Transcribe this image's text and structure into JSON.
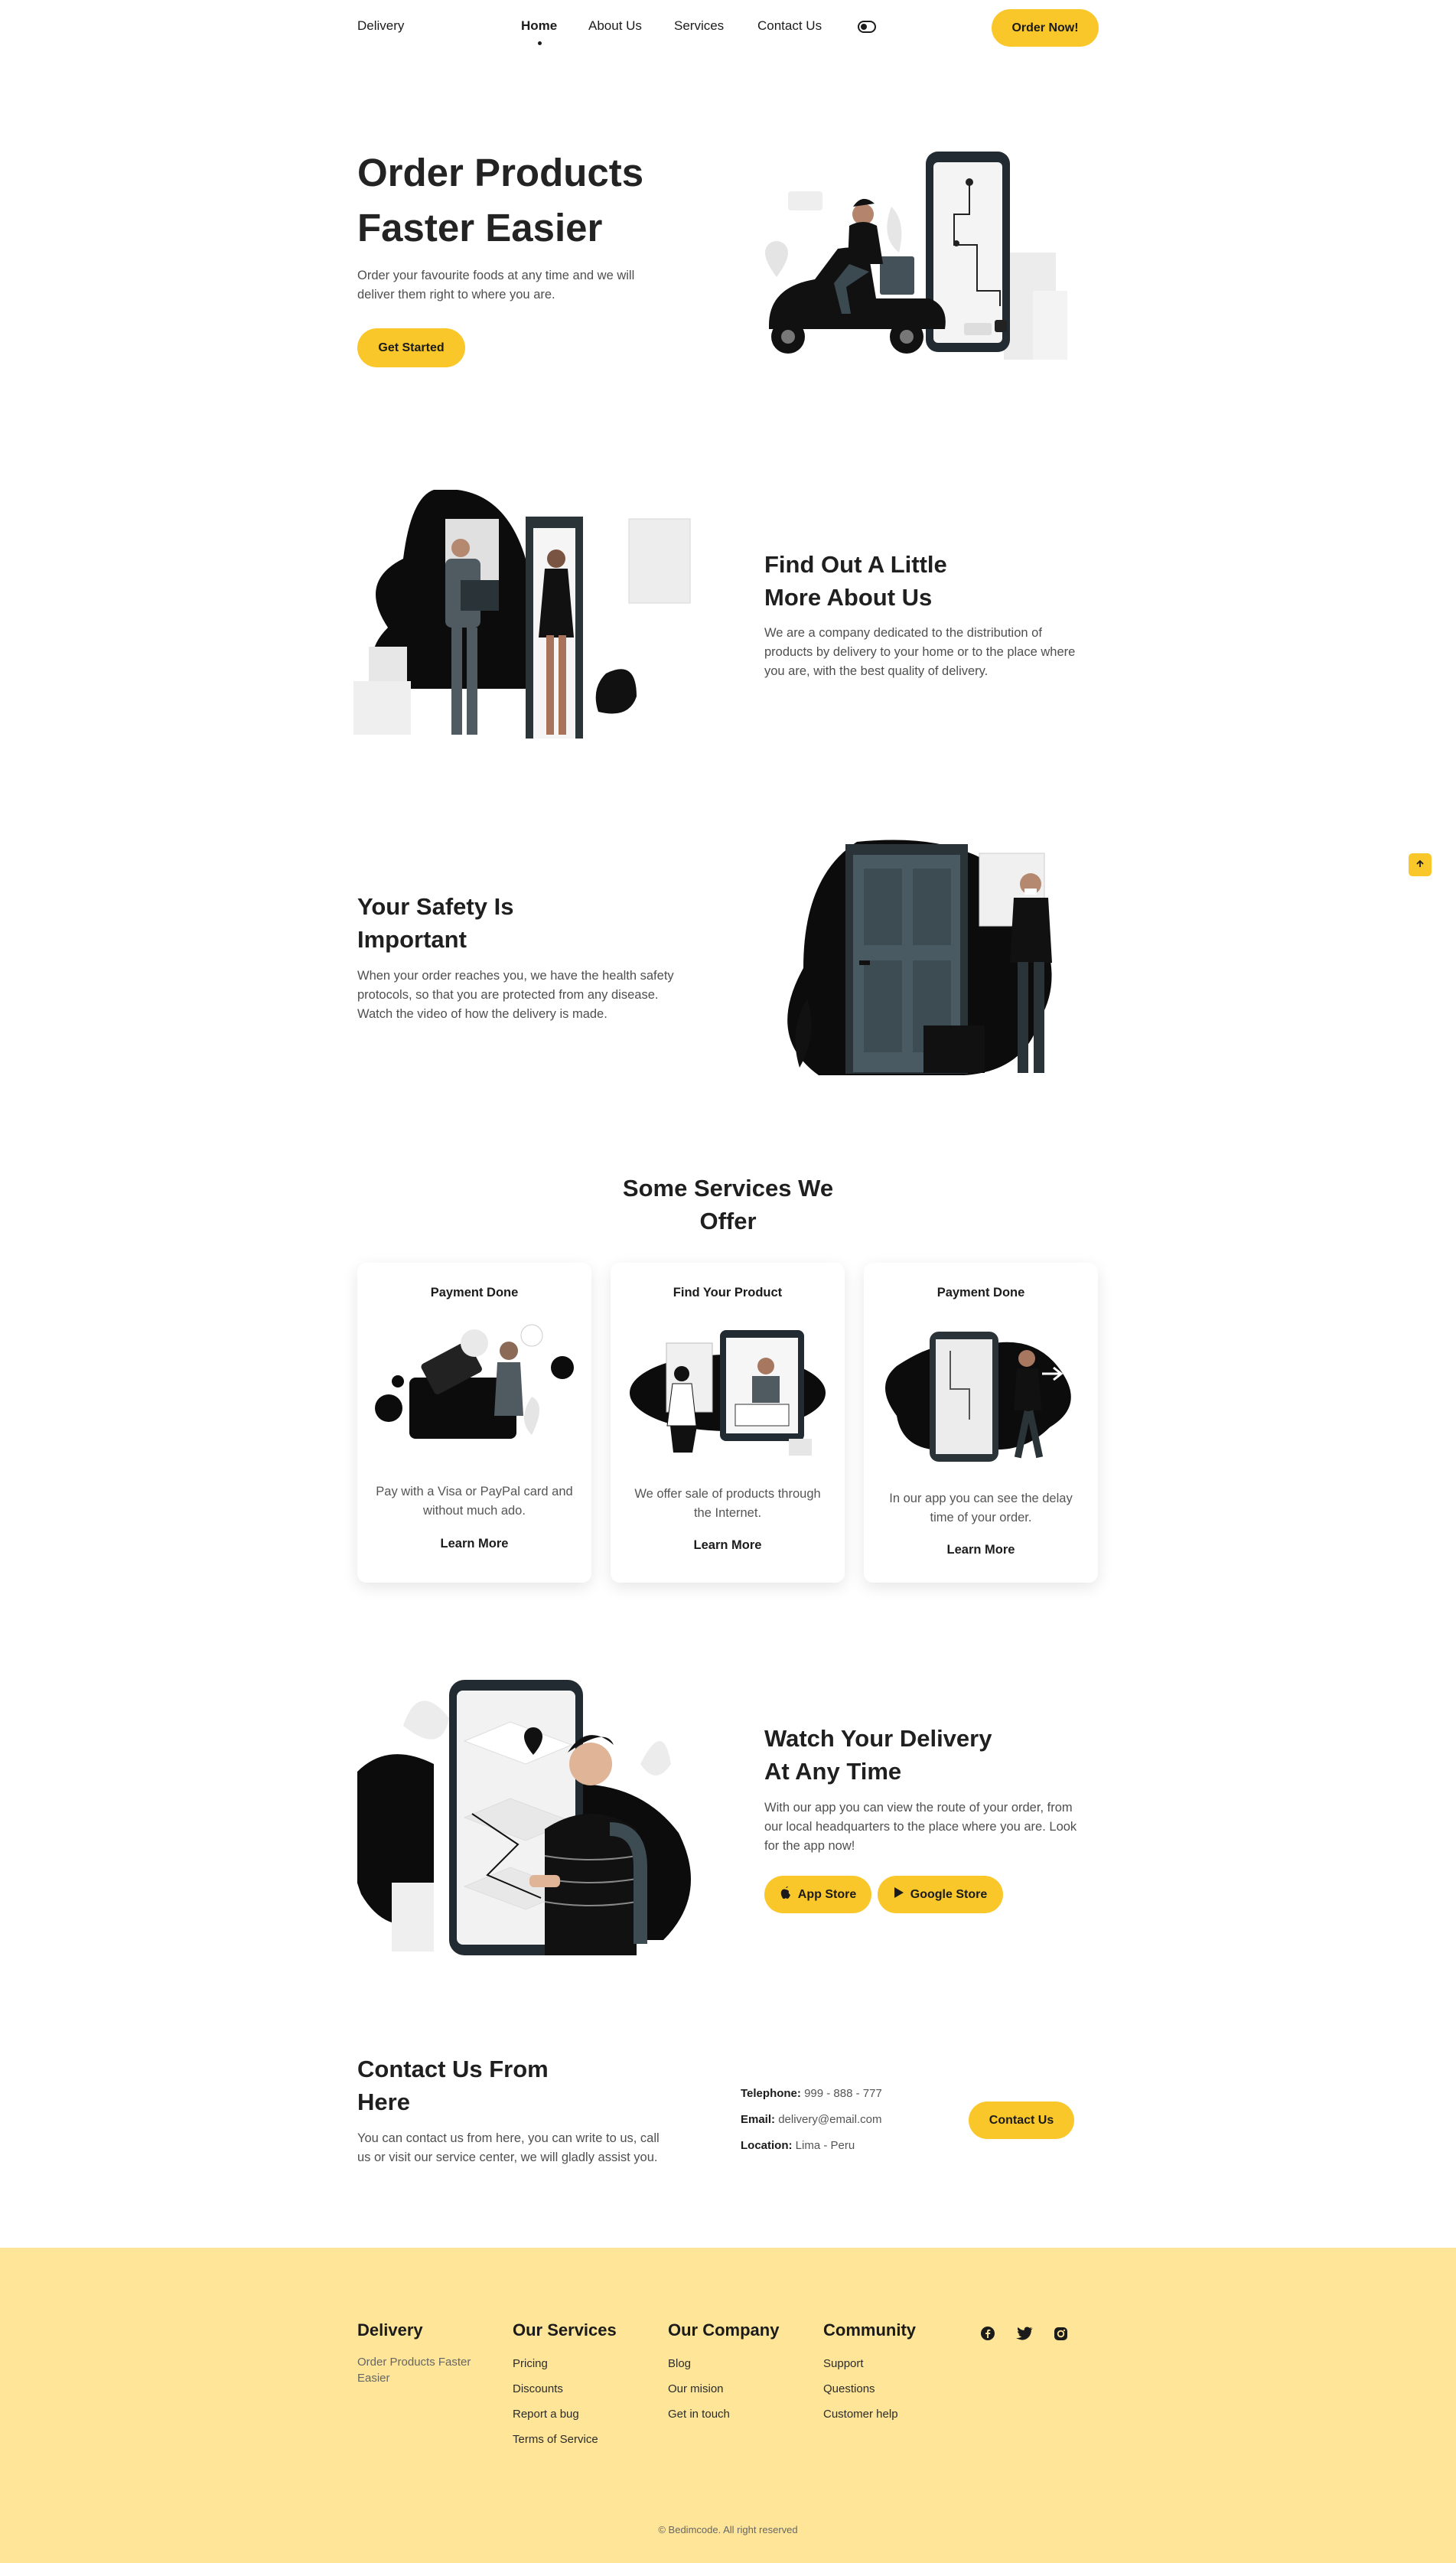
{
  "header": {
    "logo": "Delivery",
    "nav": [
      "Home",
      "About Us",
      "Services",
      "Contact Us"
    ],
    "theme_toggle_icon": "toggle-icon",
    "cta": "Order Now!"
  },
  "hero": {
    "title_line1": "Order Products",
    "title_line2": "Faster Easier",
    "description": "Order your favourite foods at any time and we will deliver them right to where you are.",
    "button": "Get Started",
    "illustration": "delivery-scooter-phone-illustration"
  },
  "about": {
    "title": "Find Out A Little More About Us",
    "description": "We are a company dedicated to the distribution of products by delivery to your home or to the place where you are, with the best quality of delivery.",
    "illustration": "door-delivery-illustration"
  },
  "safety": {
    "title": "Your Safety Is Important",
    "description": "When your order reaches you, we have the health safety protocols, so that you are protected from any disease. Watch the video of how the delivery is made.",
    "illustration": "masked-courier-door-illustration"
  },
  "scroll_up_icon": "arrow-up-icon",
  "services": {
    "title": "Some Services We Offer",
    "cards": [
      {
        "title": "Payment Done",
        "description": "Pay with a Visa or PayPal card and without much ado.",
        "link": "Learn More"
      },
      {
        "title": "Find Your Product",
        "description": "We offer sale of products through the Internet.",
        "link": "Learn More"
      },
      {
        "title": "Payment Done",
        "description": "In our app you can see the delay time of your order.",
        "link": "Learn More"
      }
    ]
  },
  "app": {
    "title": "Watch Your Delivery At Any Time",
    "description": "With our app you can view the route of your order, from our local headquarters to the place where you are. Look for the app now!",
    "buttons": [
      "App Store",
      "Google Store"
    ]
  },
  "contact": {
    "title": "Contact Us From Here",
    "description": "You can contact us from here, you can write to us, call us or visit our service center, we will gladly assist you.",
    "telephone_label": "Telephone:",
    "telephone": "999 - 888 - 777",
    "email_label": "Email:",
    "email": "delivery@email.com",
    "location_label": "Location:",
    "location": "Lima - Peru",
    "button": "Contact Us"
  },
  "footer": {
    "brand": "Delivery",
    "tagline": "Order Products Faster Easier",
    "columns": [
      {
        "title": "Our Services",
        "links": [
          "Pricing",
          "Discounts",
          "Report a bug",
          "Terms of Service"
        ]
      },
      {
        "title": "Our Company",
        "links": [
          "Blog",
          "Our mision",
          "Get in touch"
        ]
      },
      {
        "title": "Community",
        "links": [
          "Support",
          "Questions",
          "Customer help"
        ]
      }
    ],
    "social": [
      "facebook-icon",
      "twitter-icon",
      "instagram-icon"
    ],
    "copyright": "© Bedimcode. All right reserved"
  },
  "colors": {
    "accent": "#f9c72a",
    "footer_bg": "#fee598",
    "text": "#1c1c1c",
    "muted": "#555555"
  }
}
